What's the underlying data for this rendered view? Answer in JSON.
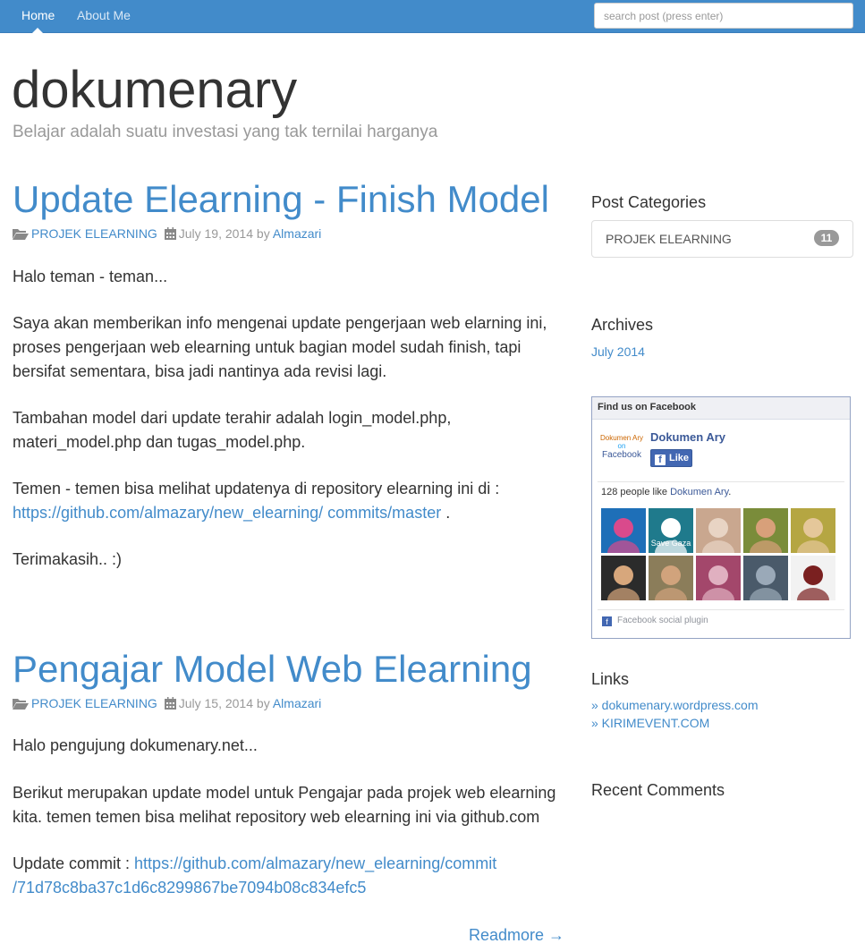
{
  "nav": {
    "home": "Home",
    "about": "About Me",
    "search_placeholder": "search post (press enter)"
  },
  "header": {
    "title": "dokumenary",
    "tagline": "Belajar adalah suatu investasi yang tak ternilai harganya"
  },
  "posts": [
    {
      "title": "Update Elearning - Finish Model",
      "category": "PROJEK ELEARNING",
      "date": "July 19, 2014",
      "by": "by",
      "author": "Almazari",
      "p1": "Halo teman - teman...",
      "p2": "Saya akan memberikan info mengenai update pengerjaan web elarning ini, proses pengerjaan web elearning untuk bagian model sudah finish, tapi bersifat sementara, bisa jadi nantinya ada revisi lagi.",
      "p3": "Tambahan model dari update terahir adalah login_model.php, materi_model.php dan tugas_model.php.",
      "p4_text": "Temen - temen bisa melihat updatenya di repository elearning ini di :",
      "p4_link": "https://github.com/almazary/new_elearning/ commits/master",
      "p4_end": " .",
      "p5": "Terimakasih.. :)"
    },
    {
      "title": "Pengajar Model Web Elearning",
      "category": "PROJEK ELEARNING",
      "date": "July 15, 2014",
      "by": "by",
      "author": "Almazari",
      "p1": "Halo pengujung dokumenary.net...",
      "p2": "Berikut merupakan update model untuk Pengajar pada projek web elearning kita. temen temen bisa melihat repository web elearning ini via github.com",
      "p3_text": "Update commit : ",
      "p3_link_a": "https://github.com/almazary/new_elearning/commit",
      "p3_link_b": "/71d78c8ba37c1d6c8299867be7094b08c834efc5",
      "readmore": "Readmore →"
    }
  ],
  "sidebar": {
    "categories_heading": "Post Categories",
    "category_label": "PROJEK ELEARNING",
    "category_count": "11",
    "archives_heading": "Archives",
    "archive_item": "July 2014",
    "facebook": {
      "header": "Find us on Facebook",
      "logo_line1": "Dokumen Ary",
      "logo_line2": "on",
      "logo_line3": "Facebook",
      "page_name": "Dokumen Ary",
      "like_label": "Like",
      "count_text": "128 people like ",
      "count_link": "Dokumen Ary",
      "count_end": ".",
      "plugin_label": "Facebook social plugin",
      "faces": [
        {
          "caption": "",
          "bg": "#1e6fb8",
          "fg": "#d94a8c"
        },
        {
          "caption": "Save Gaza",
          "bg": "#1f7a8c",
          "fg": "#ffffff"
        },
        {
          "caption": "",
          "bg": "#c9a78f",
          "fg": "#e8d4c4"
        },
        {
          "caption": "",
          "bg": "#7a8c3a",
          "fg": "#d8a07a"
        },
        {
          "caption": "",
          "bg": "#b5a642",
          "fg": "#e5c79a"
        },
        {
          "caption": "",
          "bg": "#2b2b2b",
          "fg": "#d7a77c"
        },
        {
          "caption": "",
          "bg": "#8b7d5a",
          "fg": "#d1a37c"
        },
        {
          "caption": "",
          "bg": "#a3476b",
          "fg": "#e0b0c0"
        },
        {
          "caption": "",
          "bg": "#4a5a6a",
          "fg": "#9aa9b8"
        },
        {
          "caption": "",
          "bg": "#f2f2f2",
          "fg": "#7a2020"
        }
      ]
    },
    "links_heading": "Links",
    "links": [
      "» dokumenary.wordpress.com",
      "» KIRIMEVENT.COM"
    ],
    "recent_comments_heading": "Recent Comments"
  }
}
